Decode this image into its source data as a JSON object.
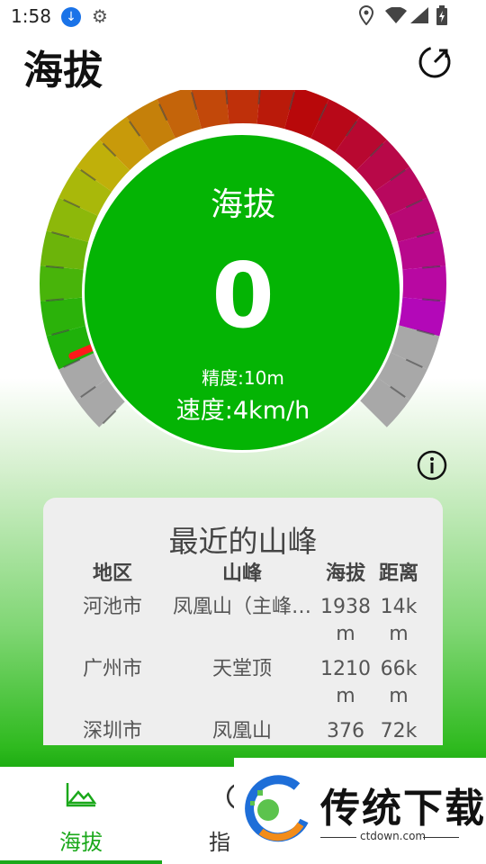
{
  "status": {
    "time": "1:58"
  },
  "header": {
    "title": "海拔"
  },
  "gauge": {
    "label": "海拔",
    "value": "0",
    "accuracy": "精度:10m",
    "speed": "速度:4km/h",
    "needle_fraction": 0.0
  },
  "peaks": {
    "title": "最近的山峰",
    "headers": {
      "region": "地区",
      "peak": "山峰",
      "altitude": "海拔",
      "distance": "距离"
    },
    "rows": [
      {
        "region": "河池市",
        "peak": "凤凰山（主峰…",
        "alt1": "1938",
        "alt2": "m",
        "dist1": "14k",
        "dist2": "m"
      },
      {
        "region": "广州市",
        "peak": "天堂顶",
        "alt1": "1210",
        "alt2": "m",
        "dist1": "66k",
        "dist2": "m"
      },
      {
        "region": "深圳市",
        "peak": "凤凰山",
        "alt1": "376",
        "alt2": "",
        "dist1": "72k",
        "dist2": ""
      }
    ]
  },
  "nav": {
    "tab1": "海拔",
    "tab2": "指"
  },
  "watermark": {
    "brand": "传统下载",
    "url": "ctdown.com"
  },
  "colors": {
    "accent": "#04b404",
    "needle": "#ff1a1a"
  }
}
